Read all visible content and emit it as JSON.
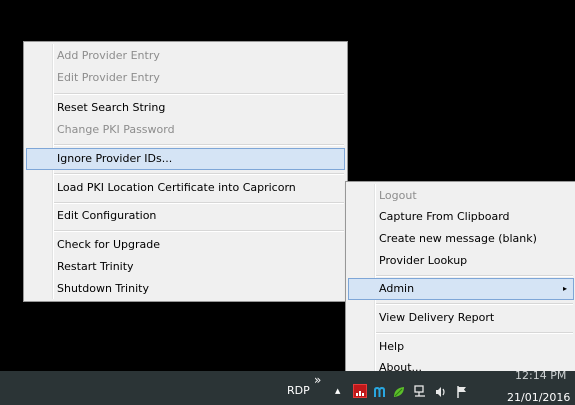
{
  "menu_main": {
    "items": [
      {
        "label": "Add Provider Entry",
        "disabled": true
      },
      {
        "label": "Edit Provider Entry",
        "disabled": true
      },
      {
        "label": "Reset Search String",
        "disabled": false
      },
      {
        "label": "Change PKI Password",
        "disabled": true
      },
      {
        "label": "Ignore Provider IDs...",
        "disabled": false,
        "highlighted": true
      },
      {
        "label": "Load PKI Location Certificate into Capricorn",
        "disabled": false
      },
      {
        "label": "Edit Configuration",
        "disabled": false
      },
      {
        "label": "Check for Upgrade",
        "disabled": false
      },
      {
        "label": "Restart Trinity",
        "disabled": false
      },
      {
        "label": "Shutdown Trinity",
        "disabled": false
      }
    ]
  },
  "menu_tray": {
    "items": [
      {
        "label": "Logout",
        "disabled": true
      },
      {
        "label": "Capture From Clipboard",
        "disabled": false
      },
      {
        "label": "Create new message (blank)",
        "disabled": false
      },
      {
        "label": "Provider Lookup",
        "disabled": false
      },
      {
        "label": "Admin",
        "disabled": false,
        "highlighted": true,
        "submenu": true
      },
      {
        "label": "View Delivery Report",
        "disabled": false
      },
      {
        "label": "Help",
        "disabled": false
      },
      {
        "label": "About...",
        "disabled": false
      }
    ],
    "submenu_arrow": "▸"
  },
  "taskbar": {
    "toolbar_label": "RDP",
    "overflow_chevron": "»",
    "tray_up_arrow": "▲",
    "time": "12:14 PM",
    "date": "21/01/2016",
    "colors": {
      "background": "#2b3436",
      "highlight": "#d5e4f5"
    }
  }
}
